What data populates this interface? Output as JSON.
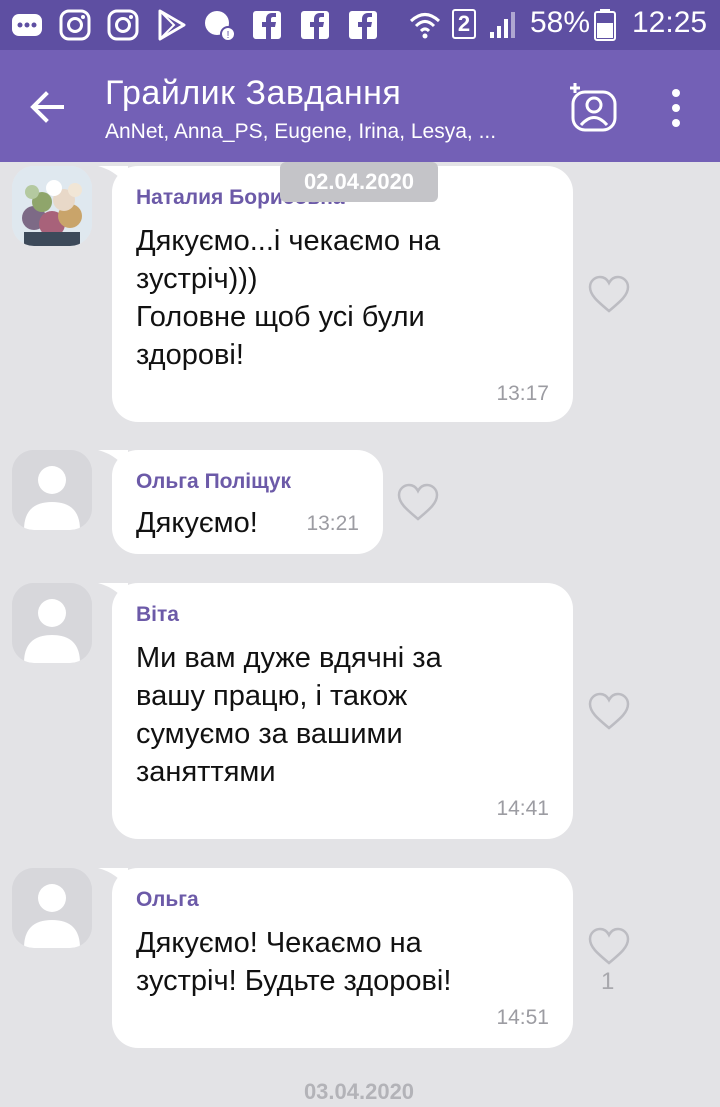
{
  "status_bar": {
    "battery": "58%",
    "time": "12:25",
    "sim_slot": "2"
  },
  "header": {
    "title": "Грайлик Завдання",
    "subtitle": "AnNet, Anna_PS, Eugene, Irina, Lesya, ..."
  },
  "chat": {
    "date_top": "02.04.2020",
    "date_bottom": "03.04.2020",
    "messages": [
      {
        "sender": "Наталия Борисовна",
        "text": "Дякуємо...і чекаємо на\nзустріч)))\nГоловне щоб усі були\nздорові!",
        "time": "13:17",
        "likes": ""
      },
      {
        "sender": "Ольга Поліщук",
        "text": "Дякуємо!",
        "time": "13:21",
        "likes": ""
      },
      {
        "sender": "Віта",
        "text": "Ми вам дуже вдячні за\nвашу працю, і також\nсумуємо за вашими\nзаняттями",
        "time": "14:41",
        "likes": ""
      },
      {
        "sender": "Ольга",
        "text": "Дякуємо!  Чекаємо на\nзустріч! Будьте здорові!",
        "time": "14:51",
        "likes": "1"
      }
    ]
  },
  "colors": {
    "status_bar": "#5e4fa2",
    "app_bar": "#7360b6",
    "background": "#e3e3e6",
    "sender_name": "#6c5aa8"
  },
  "icons": [
    "notification-icon",
    "instagram-icon",
    "play-store-icon",
    "viber-icon",
    "facebook-icon",
    "wifi-icon",
    "signal-icon",
    "battery-icon",
    "back-arrow-icon",
    "add-participant-icon",
    "more-vert-icon",
    "heart-icon"
  ]
}
